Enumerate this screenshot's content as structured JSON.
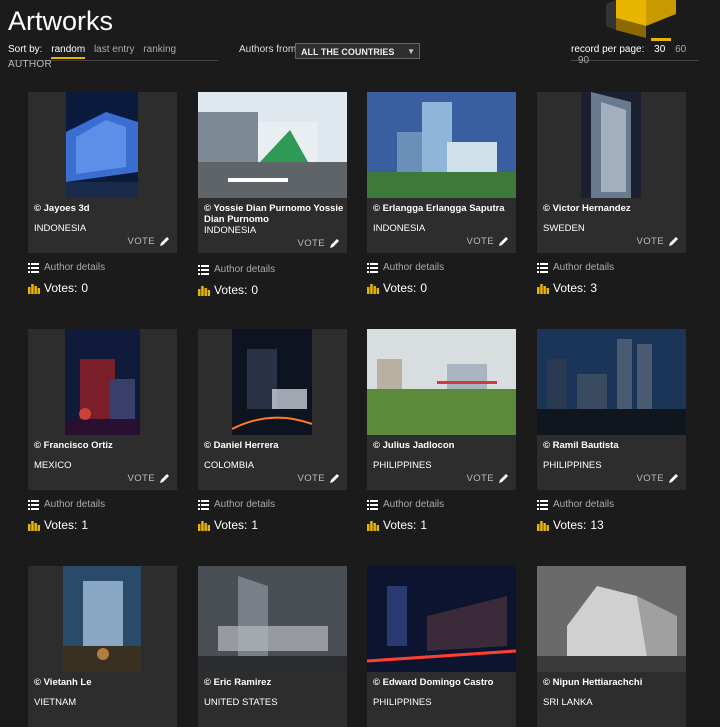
{
  "page": {
    "title": "Artworks"
  },
  "sort": {
    "label": "Sort by:",
    "options": [
      "random",
      "last entry",
      "ranking",
      "AUTHOR"
    ],
    "active": "random"
  },
  "filter": {
    "label": "Authors from",
    "selected": "ALL THE COUNTRIES"
  },
  "records": {
    "label": "record per page:",
    "options": [
      "30",
      "60",
      "90"
    ],
    "active": "30"
  },
  "card_labels": {
    "vote": "VOTE",
    "details": "Author details",
    "votes_prefix": "Votes:"
  },
  "artworks": [
    {
      "author": "© Jayoes 3d",
      "country": "INDONESIA",
      "votes": "0"
    },
    {
      "author": "© Yossie Dian Purnomo Yossie Dian Purnomo",
      "country": "INDONESIA",
      "votes": "0"
    },
    {
      "author": "© Erlangga Erlangga Saputra",
      "country": "INDONESIA",
      "votes": "0"
    },
    {
      "author": "© Victor Hernandez",
      "country": "SWEDEN",
      "votes": "3"
    },
    {
      "author": "© Francisco Ortiz",
      "country": "MEXICO",
      "votes": "1"
    },
    {
      "author": "© Daniel Herrera",
      "country": "COLOMBIA",
      "votes": "1"
    },
    {
      "author": "© Julius Jadlocon",
      "country": "PHILIPPINES",
      "votes": "1"
    },
    {
      "author": "© Ramil Bautista",
      "country": "PHILIPPINES",
      "votes": "13"
    },
    {
      "author": "© Vietanh Le",
      "country": "VIETNAM",
      "votes": ""
    },
    {
      "author": "© Eric Ramirez",
      "country": "UNITED STATES",
      "votes": ""
    },
    {
      "author": "© Edward Domingo Castro",
      "country": "PHILIPPINES",
      "votes": ""
    },
    {
      "author": "© Nipun Hettiarachchi",
      "country": "SRI LANKA",
      "votes": ""
    }
  ],
  "colors": {
    "accent": "#e8b500",
    "background": "#1b1b1b",
    "card": "#2d2d2d"
  },
  "icons": {
    "vote": "pencil-icon",
    "details": "list-icon",
    "votes": "bar-chart-icon"
  }
}
